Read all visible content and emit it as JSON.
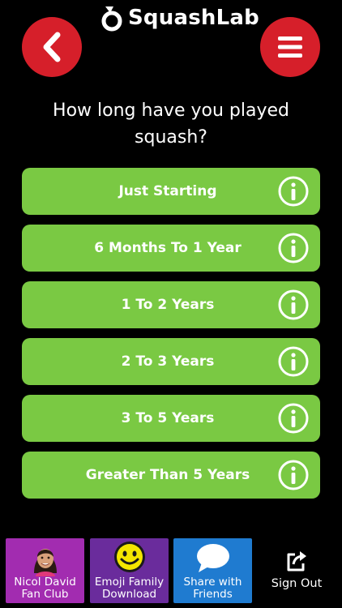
{
  "app": {
    "name": "SquashLab"
  },
  "header": {
    "back_icon": "chevron-left-icon",
    "menu_icon": "hamburger-menu-icon",
    "accent_color": "#d61f2a"
  },
  "question": {
    "text": "How long have you played squash?"
  },
  "options": [
    {
      "label": "Just Starting",
      "icon": "info-icon"
    },
    {
      "label": "6 Months To 1 Year",
      "icon": "info-icon"
    },
    {
      "label": "1 To 2 Years",
      "icon": "info-icon"
    },
    {
      "label": "2 To 3 Years",
      "icon": "info-icon"
    },
    {
      "label": "3 To 5 Years",
      "icon": "info-icon"
    },
    {
      "label": "Greater Than 5 Years",
      "icon": "info-icon"
    }
  ],
  "option_color": "#7ac943",
  "bottom_bar": {
    "nicol": {
      "label": "Nicol David\nFan Club",
      "icon": "avatar-icon",
      "color": "#a22cb0"
    },
    "emoji": {
      "label": "Emoji Family\nDownload",
      "icon": "smiley-icon",
      "color": "#6a2c9c"
    },
    "share": {
      "label": "Share with\nFriends",
      "icon": "speech-bubble-icon",
      "color": "#1f7bd0"
    },
    "signout": {
      "label": "Sign Out",
      "icon": "sign-out-icon"
    }
  }
}
